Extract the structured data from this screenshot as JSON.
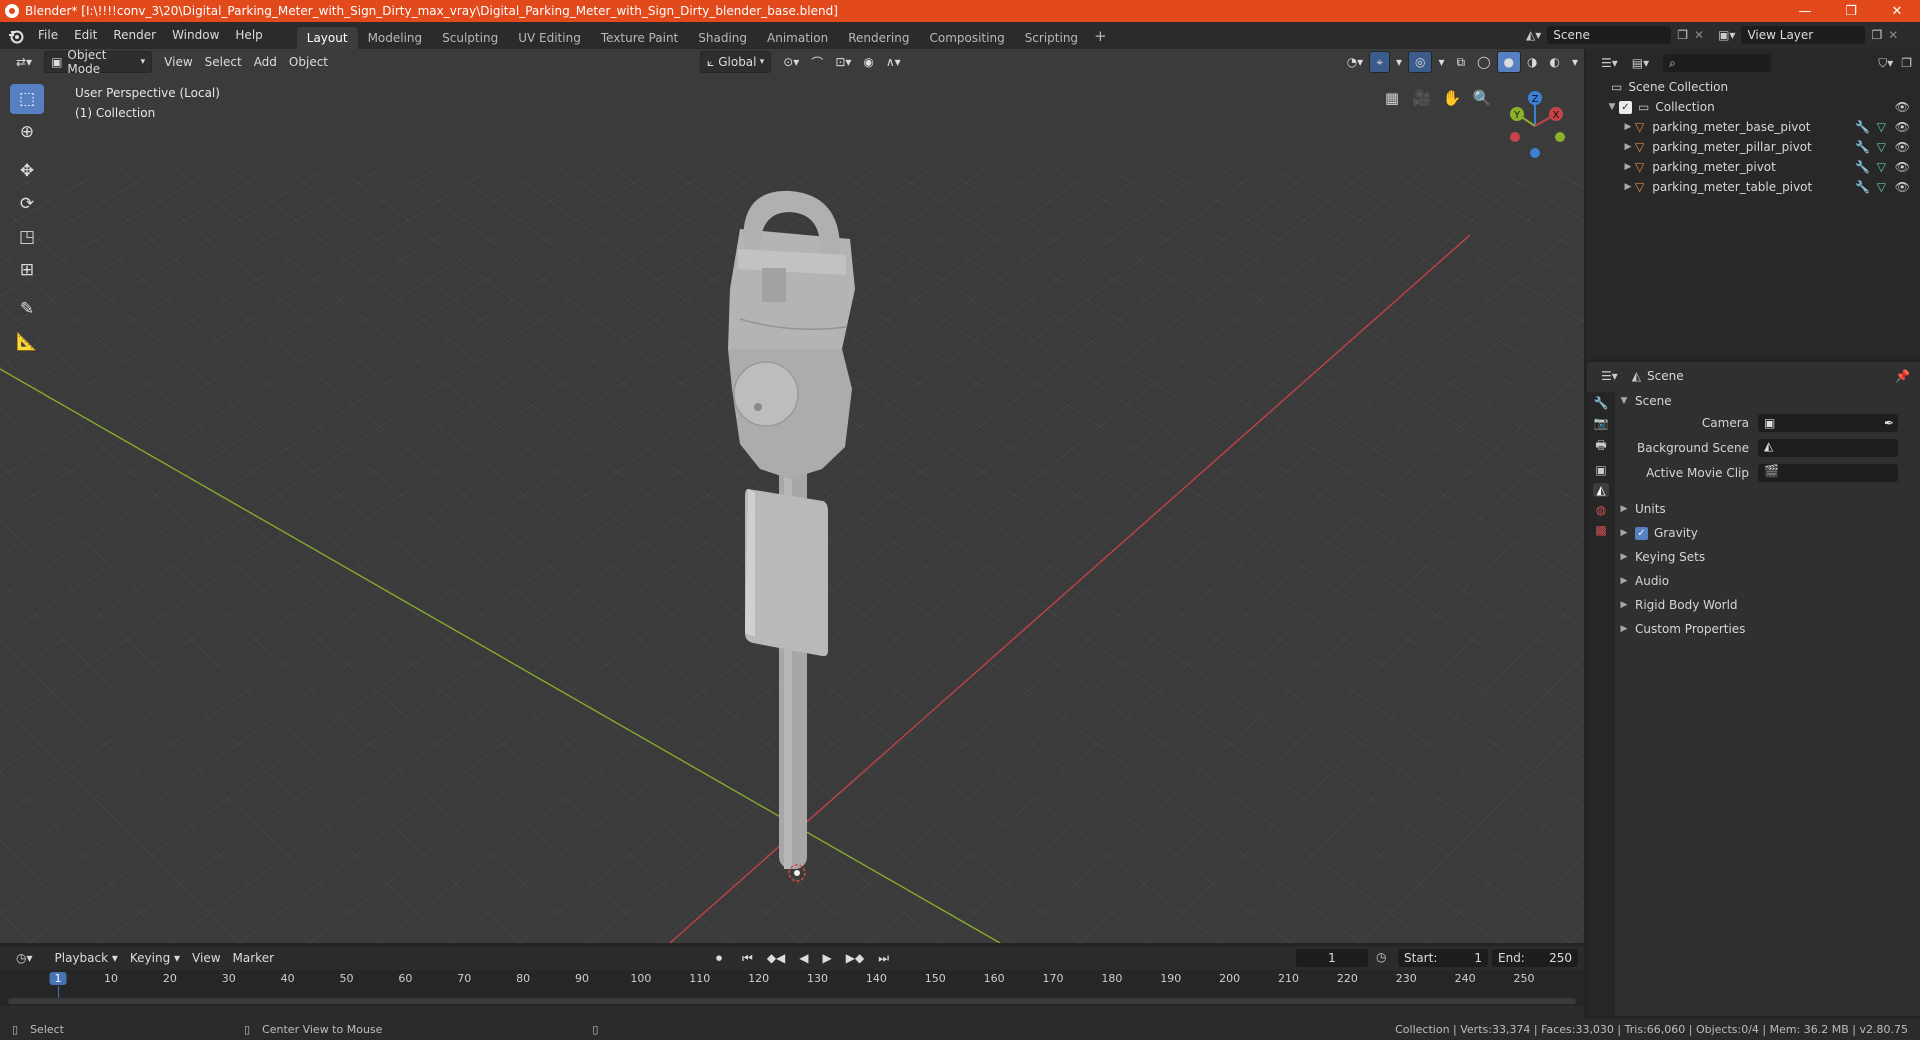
{
  "window": {
    "title": "Blender* [I:\\!!!!conv_3\\20\\Digital_Parking_Meter_with_Sign_Dirty_max_vray\\Digital_Parking_Meter_with_Sign_Dirty_blender_base.blend]",
    "min_glyph": "—",
    "restore_glyph": "❐",
    "close_glyph": "✕"
  },
  "menus": [
    "File",
    "Edit",
    "Render",
    "Window",
    "Help"
  ],
  "workspace_tabs": [
    "Layout",
    "Modeling",
    "Sculpting",
    "UV Editing",
    "Texture Paint",
    "Shading",
    "Animation",
    "Rendering",
    "Compositing",
    "Scripting"
  ],
  "active_workspace": "Layout",
  "scene_selector": {
    "value": "Scene"
  },
  "view_layer_selector": {
    "value": "View Layer"
  },
  "viewport": {
    "mode": "Object Mode",
    "menus": [
      "View",
      "Select",
      "Add",
      "Object"
    ],
    "transform_orientation": "Global",
    "overlay_text_line1": "User Perspective (Local)",
    "overlay_text_line2": "(1) Collection",
    "gizmo_axes": {
      "z": "Z",
      "y": "Y",
      "x": "X"
    },
    "colors": {
      "x_axis": "#c8424a",
      "y_axis": "#8bb02a",
      "z_axis": "#3d80d8",
      "grid": "#454545"
    }
  },
  "outliner": {
    "root": "Scene Collection",
    "collection": "Collection",
    "objects": [
      "parking_meter_base_pivot",
      "parking_meter_pillar_pivot",
      "parking_meter_pivot",
      "parking_meter_table_pivot"
    ]
  },
  "properties": {
    "context": "Scene",
    "panel_title": "Scene",
    "fields": {
      "camera_label": "Camera",
      "background_scene_label": "Background Scene",
      "active_movie_clip_label": "Active Movie Clip"
    },
    "subpanels": [
      "Units",
      "Gravity",
      "Keying Sets",
      "Audio",
      "Rigid Body World",
      "Custom Properties"
    ],
    "gravity_checked": true
  },
  "timeline": {
    "menus": [
      "Playback",
      "Keying",
      "View",
      "Marker"
    ],
    "current_frame": "1",
    "start_label": "Start:",
    "start": "1",
    "end_label": "End:",
    "end": "250",
    "ticks": [
      "1",
      "10",
      "20",
      "30",
      "40",
      "50",
      "60",
      "70",
      "80",
      "90",
      "100",
      "110",
      "120",
      "130",
      "140",
      "150",
      "160",
      "170",
      "180",
      "190",
      "200",
      "210",
      "220",
      "230",
      "240",
      "250"
    ]
  },
  "statusbar": {
    "left_action": "Select",
    "middle_action": "Center View to Mouse",
    "stats": "Collection | Verts:33,374 | Faces:33,030 | Tris:66,060 | Objects:0/4 | Mem: 36.2 MB | v2.80.75"
  }
}
